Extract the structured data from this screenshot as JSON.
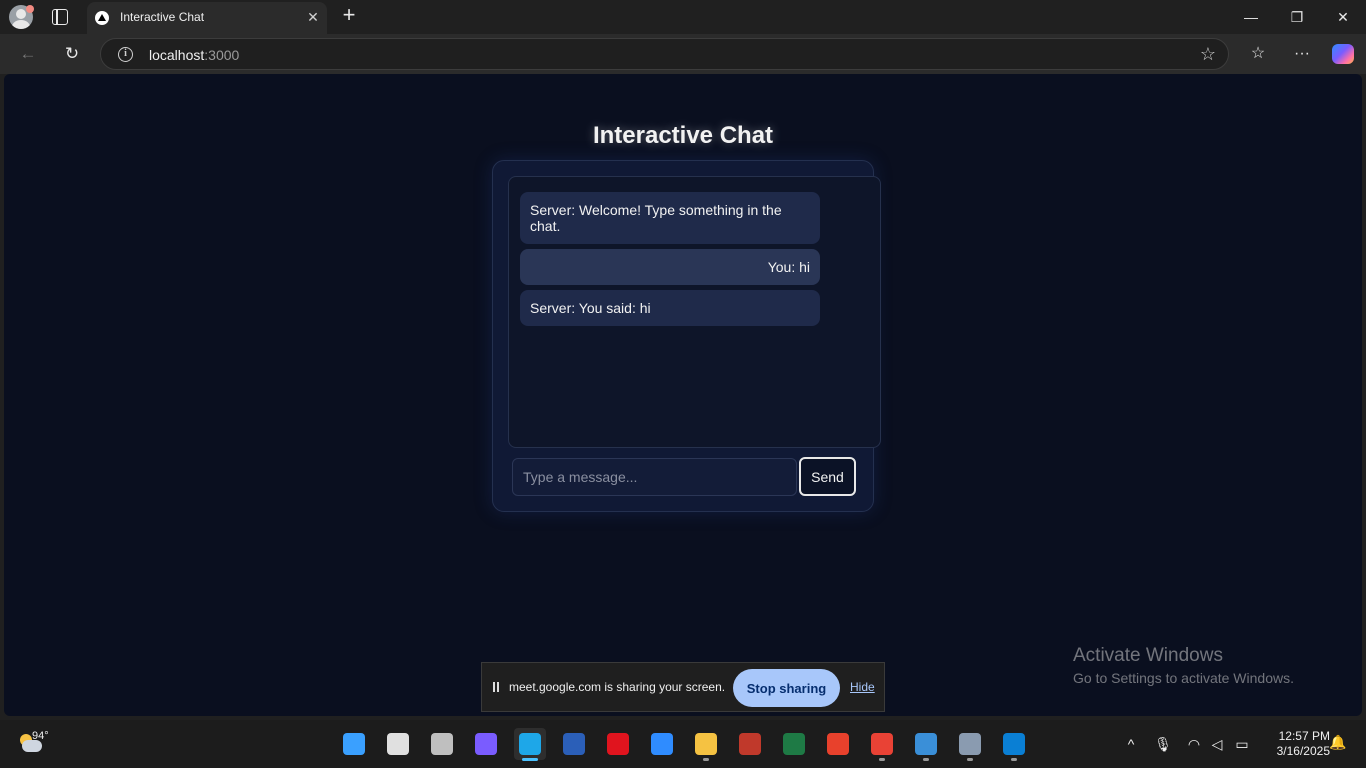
{
  "browser": {
    "tab": {
      "title": "Interactive Chat",
      "close_glyph": "✕"
    },
    "new_tab_glyph": "+",
    "window_controls": {
      "minimize": "—",
      "restore": "❐",
      "close": "✕"
    },
    "address": {
      "host": "localhost",
      "port": ":3000"
    },
    "icons": [
      "profile-icon",
      "tab-actions-icon",
      "back-icon",
      "refresh-icon",
      "site-info-icon",
      "favorite-star-icon",
      "favorites-icon",
      "more-icon",
      "copilot-icon"
    ]
  },
  "page": {
    "title": "Interactive Chat",
    "messages": [
      {
        "sender": "server",
        "text": "Server: Welcome! Type something in the chat."
      },
      {
        "sender": "user",
        "text": "You: hi"
      },
      {
        "sender": "server",
        "text": "Server: You said: hi"
      }
    ],
    "input": {
      "placeholder": "Type a message...",
      "value": ""
    },
    "send_label": "Send"
  },
  "share_bar": {
    "text": "meet.google.com is sharing your screen.",
    "stop_label": "Stop sharing",
    "hide_label": "Hide"
  },
  "watermark": {
    "title": "Activate Windows",
    "subtitle": "Go to Settings to activate Windows."
  },
  "taskbar": {
    "weather_temp": "94°",
    "apps": [
      {
        "name": "start",
        "color": "#3aa0ff",
        "running": false,
        "active": false
      },
      {
        "name": "search",
        "color": "#e0e0e0",
        "running": false,
        "active": false
      },
      {
        "name": "task-view",
        "color": "#bfbfbf",
        "running": false,
        "active": false
      },
      {
        "name": "copilot",
        "color": "#7a5cff",
        "running": false,
        "active": false
      },
      {
        "name": "edge",
        "color": "#1ea7e8",
        "running": true,
        "active": true
      },
      {
        "name": "word",
        "color": "#2b5fb8",
        "running": false,
        "active": false
      },
      {
        "name": "opera",
        "color": "#e0141e",
        "running": false,
        "active": false
      },
      {
        "name": "microsoft-store",
        "color": "#2f8cff",
        "running": false,
        "active": false
      },
      {
        "name": "file-explorer",
        "color": "#f5c242",
        "running": true,
        "active": false
      },
      {
        "name": "photo-app",
        "color": "#c0392b",
        "running": false,
        "active": false
      },
      {
        "name": "excel",
        "color": "#1e7a45",
        "running": false,
        "active": false
      },
      {
        "name": "wps-office",
        "color": "#e8412c",
        "running": false,
        "active": false
      },
      {
        "name": "chrome",
        "color": "#e94235",
        "running": true,
        "active": false
      },
      {
        "name": "waves-app",
        "color": "#3a8fd8",
        "running": true,
        "active": false
      },
      {
        "name": "camera",
        "color": "#8a9bb0",
        "running": true,
        "active": false
      },
      {
        "name": "vs-code",
        "color": "#0a7fd4",
        "running": true,
        "active": false
      }
    ],
    "clock": {
      "time": "12:57 PM",
      "date": "3/16/2025"
    }
  }
}
